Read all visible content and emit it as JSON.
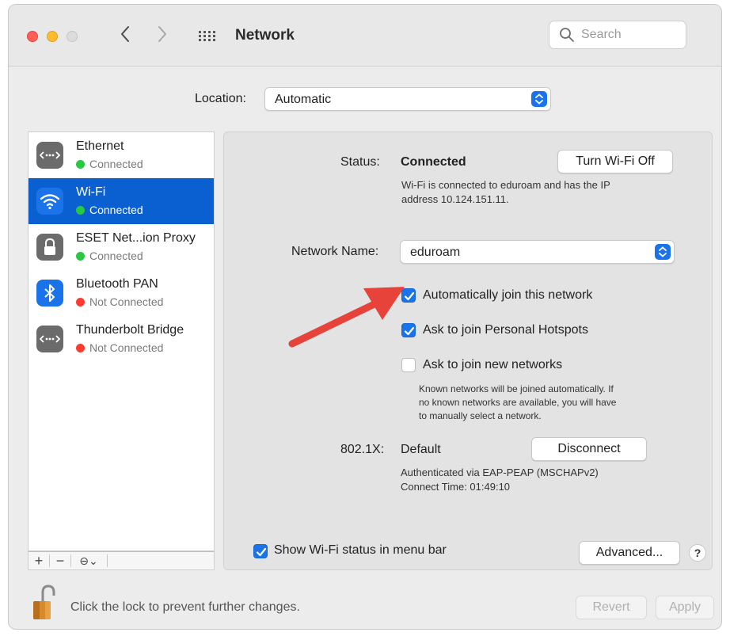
{
  "window": {
    "title": "Network",
    "search_placeholder": "Search"
  },
  "location": {
    "label": "Location:",
    "value": "Automatic"
  },
  "services": [
    {
      "name": "Ethernet",
      "status": "Connected",
      "status_color": "#28c840",
      "icon": "ethernet-icon",
      "selected": false
    },
    {
      "name": "Wi-Fi",
      "status": "Connected",
      "status_color": "#28c840",
      "icon": "wifi-icon",
      "selected": true
    },
    {
      "name": "ESET Net...ion Proxy",
      "status": "Connected",
      "status_color": "#28c840",
      "icon": "lock-icon",
      "selected": false
    },
    {
      "name": "Bluetooth PAN",
      "status": "Not Connected",
      "status_color": "#ff3b30",
      "icon": "bluetooth-icon",
      "selected": false
    },
    {
      "name": "Thunderbolt Bridge",
      "status": "Not Connected",
      "status_color": "#ff3b30",
      "icon": "ethernet-icon",
      "selected": false
    }
  ],
  "sidebar_toolbar": {
    "add": "+",
    "remove": "−",
    "action": "⊖⌄"
  },
  "wifi": {
    "status_label": "Status:",
    "status_value": "Connected",
    "toggle_button": "Turn Wi-Fi Off",
    "status_desc_line1": "Wi-Fi is connected to eduroam and has the IP",
    "status_desc_line2": "address 10.124.151.11.",
    "network_name_label": "Network Name:",
    "network_name_value": "eduroam",
    "auto_join_label": "Automatically join this network",
    "auto_join_checked": true,
    "hotspots_label": "Ask to join Personal Hotspots",
    "hotspots_checked": true,
    "new_networks_label": "Ask to join new networks",
    "new_networks_checked": false,
    "known_desc_line1": "Known networks will be joined automatically. If",
    "known_desc_line2": "no known networks are available, you will have",
    "known_desc_line3": "to manually select a network.",
    "dot1x_label": "802.1X:",
    "dot1x_value": "Default",
    "disconnect_button": "Disconnect",
    "auth_line1": "Authenticated via EAP-PEAP (MSCHAPv2)",
    "auth_line2": "Connect Time: 01:49:10",
    "show_status_label": "Show Wi-Fi status in menu bar",
    "show_status_checked": true,
    "advanced_button": "Advanced...",
    "help_button": "?"
  },
  "footer": {
    "lock_text": "Click the lock to prevent further changes.",
    "revert_button": "Revert",
    "apply_button": "Apply"
  },
  "colors": {
    "accent": "#1a73e8",
    "selection": "#0a5fd1",
    "connected": "#28c840",
    "not_connected": "#ff3b30",
    "annotation_arrow": "#e8433b"
  }
}
